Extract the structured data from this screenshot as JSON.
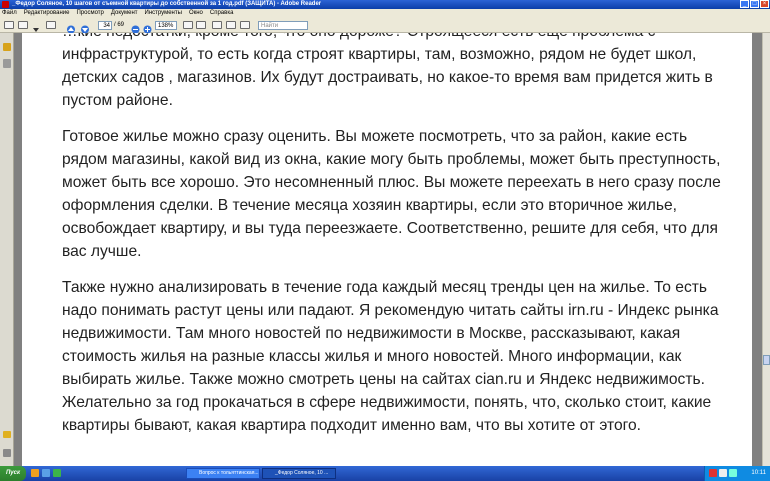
{
  "window": {
    "title": "_Федор Соляное, 10 шагов от съемной квартиры до собственной за 1 год.pdf (ЗАЩИТА) - Adobe Reader"
  },
  "menu": {
    "items": [
      "Файл",
      "Редактирование",
      "Просмотр",
      "Документ",
      "Инструменты",
      "Окно",
      "Справка"
    ]
  },
  "toolbar": {
    "page_number": "34",
    "page_total": "/ 69",
    "zoom": "138%",
    "find_placeholder": "Найти"
  },
  "document": {
    "paragraphs": [
      "…кие недостатки, кроме того, что оно дороже? Строящееся есть еще проблема с инфраструктурой, то есть когда строят квартиры, там, возможно, рядом не будет школ, детских садов , магазинов. Их будут достраивать, но какое-то время вам придется жить в пустом районе.",
      "Готовое жилье можно сразу оценить. Вы можете посмотреть, что за район, какие есть рядом магазины, какой вид из окна, какие могу быть проблемы, может быть преступность, может быть все хорошо. Это несомненный плюс. Вы можете переехать в него сразу после оформления сделки. В течение месяца хозяин квартиры, если это вторичное жилье, освобождает квартиру, и вы туда переезжаете. Соответственно, решите для себя, что для вас лучше.",
      "Также нужно анализировать в течение года каждый месяц тренды цен на жилье. То есть надо понимать растут цены или падают. Я рекомендую читать сайты irn.ru - Индекс рынка недвижимости. Там много новостей по недвижимости в Москве, рассказывают, какая стоимость жилья на разные классы жилья и много новостей. Много информации, как выбирать жилье. Также можно смотреть цены на сайтах cian.ru и Яндекс недвижимость. Желательно за год прокачаться в сфере недвижимости, понять, что, сколько стоит, какие квартиры бывают, какая квартира подходит именно вам, что вы хотите от этого."
    ]
  },
  "taskbar": {
    "start_label": "Пуск",
    "tasks": [
      {
        "label": "Вопрос к тольяттинская..."
      },
      {
        "label": "_Федор Соляное, 10 ..."
      }
    ],
    "clock": "10:11"
  },
  "colors": {
    "titlebar": "#0b3ea8",
    "taskbar": "#1941a5",
    "document_bg": "#808080"
  }
}
